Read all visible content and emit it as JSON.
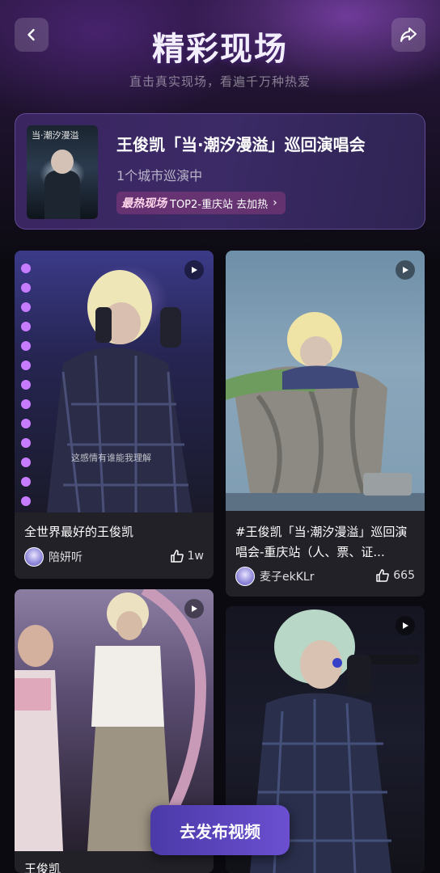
{
  "header": {
    "title": "精彩现场",
    "subtitle": "直击真实现场，看遍千万种热爱",
    "back_icon": "chevron-left-icon",
    "share_icon": "share-arrow-icon"
  },
  "concert": {
    "name": "王俊凯「当·潮汐漫溢」巡回演唱会",
    "city_count": "1个城市巡演中",
    "hot_label": "最热现场",
    "hot_text": "TOP2-重庆站 去加热",
    "poster_text": "当·潮汐漫溢"
  },
  "videos": [
    {
      "title": "全世界最好的王俊凯",
      "author": "陪妍听",
      "likes": "1w",
      "subtitle_overlay": "这感情有谁能我理解"
    },
    {
      "title": "#王俊凯「当·潮汐漫溢」巡回演唱会-重庆站（人、票、证...",
      "author": "麦子ekKLr",
      "likes": "665"
    },
    {
      "title": "王俊凯",
      "author": "",
      "likes": ""
    },
    {
      "title": "",
      "author": "",
      "likes": ""
    }
  ],
  "publish_button": "去发布视频",
  "colors": {
    "background": "#0b0a10",
    "accent": "#6b4fd0",
    "card": "#222128"
  }
}
